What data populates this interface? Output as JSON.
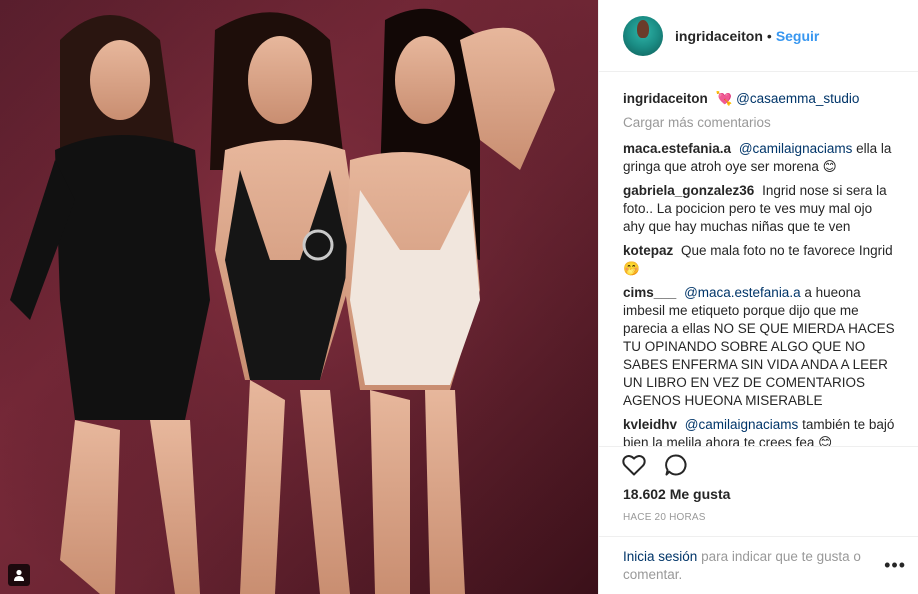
{
  "post": {
    "author": "ingridaceiton",
    "follow_label": "Seguir",
    "separator": "•"
  },
  "caption": {
    "user": "ingridaceiton",
    "emoji": "💘",
    "mention": "@casaemma_studio"
  },
  "load_more_label": "Cargar más comentarios",
  "comments": [
    {
      "user": "maca.estefania.a",
      "mention": "@camilaignaciams",
      "text": "ella la gringa que atroh oye ser morena 😊"
    },
    {
      "user": "gabriela_gonzalez36",
      "mention": "",
      "text": "Ingrid nose si sera la foto.. La pocicion pero te ves muy mal ojo ahy que hay muchas niñas que te ven"
    },
    {
      "user": "kotepaz",
      "mention": "",
      "text": "Que mala foto no te favorece Ingrid 🤭"
    },
    {
      "user": "cims___",
      "mention": "@maca.estefania.a",
      "text": "a hueona imbesil me etiqueto porque dijo que me parecia a ellas NO SE QUE MIERDA HACES TU OPINANDO SOBRE ALGO QUE NO SABES ENFERMA SIN VIDA ANDA A LEER UN LIBRO EN VEZ DE COMENTARIOS AGENOS HUEONA MISERABLE"
    },
    {
      "user": "kvleidhv",
      "mention": "@camilaignaciams",
      "text": "también te bajó bien la melila ahora te crees fea 😊"
    }
  ],
  "likes_label": "18.602 Me gusta",
  "timestamp": "HACE 20 HORAS",
  "login_prompt": {
    "link": "Inicia sesión",
    "text": "para indicar que te gusta o comentar."
  },
  "more_options_label": "•••",
  "icons": {
    "like": "heart-icon",
    "comment": "comment-icon",
    "user_tag": "user-tag-icon",
    "more": "more-options-icon"
  },
  "colors": {
    "link_blue": "#3897f0",
    "mention_blue": "#003569",
    "muted": "#999999",
    "photo_backdrop": "#6b2533"
  }
}
